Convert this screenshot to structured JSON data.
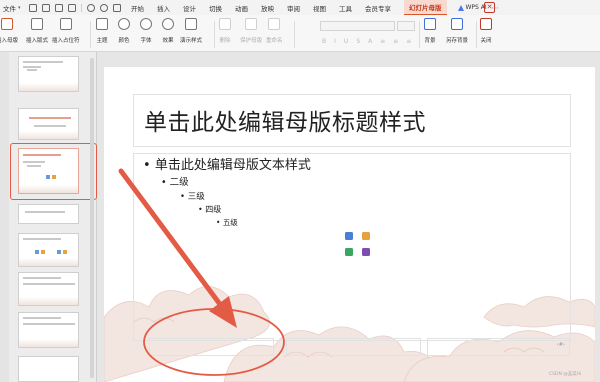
{
  "menubar": {
    "file_label": "文件",
    "menus": [
      "开始",
      "插入",
      "设计",
      "切换",
      "动画",
      "放映",
      "审阅",
      "视图",
      "工具",
      "会员专享"
    ],
    "active_tab": "幻灯片母版",
    "wps_ai": "WPS AI"
  },
  "ribbon": {
    "insert_master": "插入母版",
    "insert_layout": "插入版式",
    "insert_placeholder": "插入占位符",
    "theme": "主题",
    "colors": "颜色",
    "fonts": "字体",
    "effects": "效果",
    "background_style": "演示样式",
    "delete": "删除",
    "preserve_master": "保护母版",
    "rename": "重命名",
    "background": "背景",
    "save_background": "另存背景",
    "close": "关闭"
  },
  "slide": {
    "title": "单击此处编辑母版标题样式",
    "level1": "单击此处编辑母版文本样式",
    "level2": "二级",
    "level3": "三级",
    "level4": "四级",
    "level5": "五级",
    "footer_num": "‹#›"
  },
  "thumbnails": {
    "t1_title": "单击此处编辑母版标题样式",
    "t2_title": "单击此处编辑母版标题样式",
    "t4_title": "单击此处编辑母版标题样式",
    "t5_title": "单击此处编辑母版标题样式",
    "t6_title": "单击此处编辑母版标题样式"
  },
  "watermark": "CSDN @韭菜Hi",
  "colors": {
    "accent": "#d9532b",
    "annotation": "#e45b45"
  }
}
